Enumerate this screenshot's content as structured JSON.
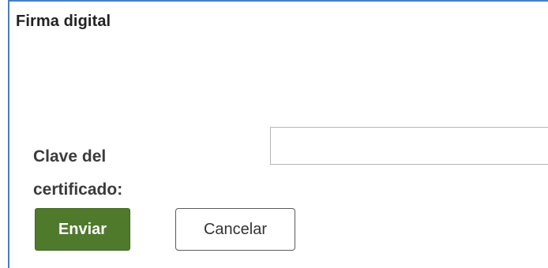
{
  "dialog": {
    "title": "Firma digital",
    "password_label": "Clave del\ncertificado:",
    "password_value": "",
    "send_label": "Enviar",
    "cancel_label": "Cancelar"
  },
  "colors": {
    "accent_border": "#4a7fc1",
    "send_button": "#4f7a2b"
  }
}
